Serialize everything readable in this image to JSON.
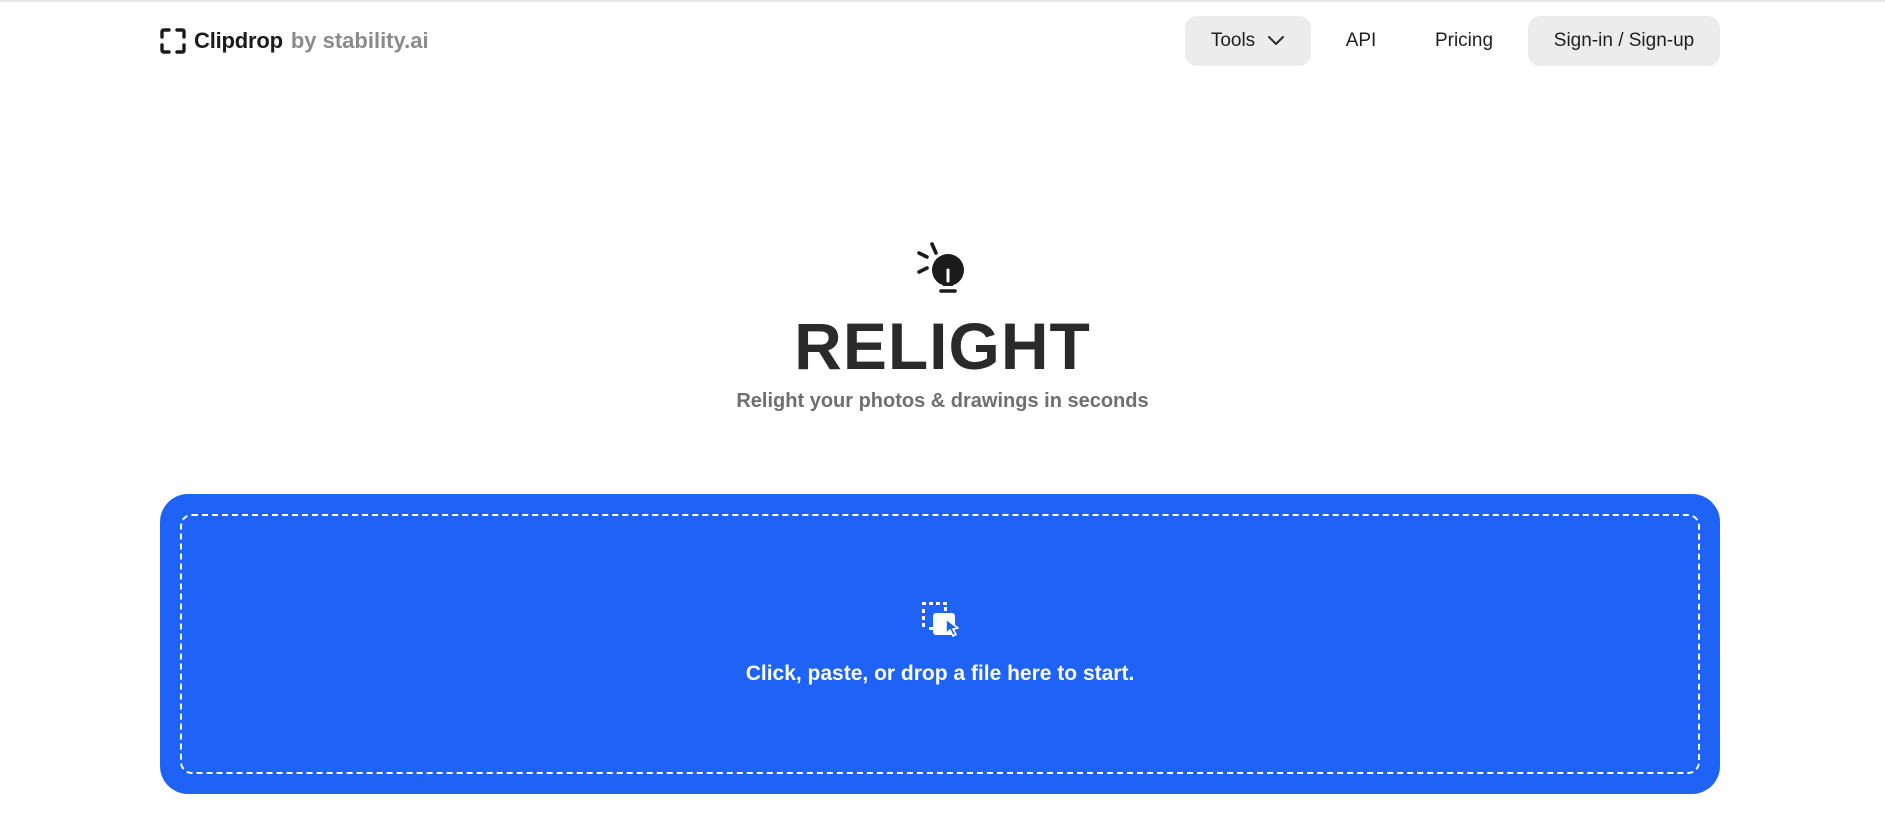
{
  "header": {
    "brand_name": "Clipdrop",
    "brand_suffix": "by stability.ai",
    "brand_icon": "clipdrop-logo-icon",
    "nav": {
      "tools_label": "Tools",
      "api_label": "API",
      "pricing_label": "Pricing",
      "signin_label": "Sign-in / Sign-up"
    }
  },
  "hero": {
    "icon": "lightbulb-icon",
    "title": "RELIGHT",
    "subtitle": "Relight your photos & drawings in seconds"
  },
  "dropzone": {
    "icon": "drop-file-icon",
    "text": "Click, paste, or drop a file here to start."
  },
  "colors": {
    "accent": "#1e63f5",
    "nav_button_bg": "#ececec",
    "title": "#2a2a2a",
    "subtitle": "#6f6f6f"
  }
}
